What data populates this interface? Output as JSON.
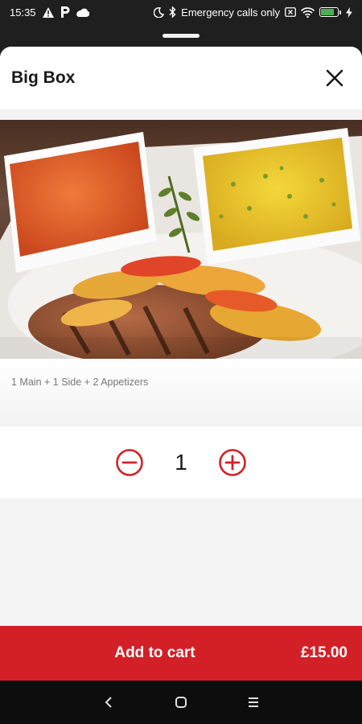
{
  "status_bar": {
    "time": "15:35",
    "network_text": "Emergency calls only",
    "battery_level": 0.8,
    "icons": [
      "alert-icon",
      "parking-icon",
      "cloud-icon",
      "moon-icon",
      "bluetooth-icon",
      "wifi-icon",
      "sim-icon",
      "battery-icon",
      "charging-icon"
    ]
  },
  "sheet": {
    "title": "Big Box",
    "description": "1 Main + 1 Side + 2 Appetizers",
    "quantity": "1"
  },
  "cart": {
    "label": "Add to cart",
    "price": "£15.00"
  },
  "colors": {
    "accent": "#d32027",
    "background": "#f3f3f3"
  },
  "nav": {
    "icons": [
      "back-icon",
      "home-icon",
      "menu-icon"
    ]
  }
}
